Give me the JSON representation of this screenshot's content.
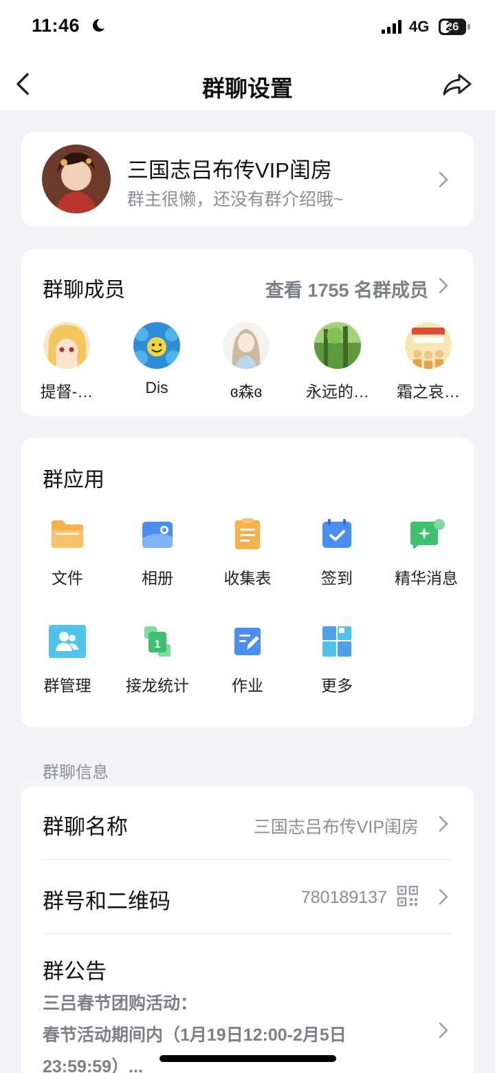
{
  "status_bar": {
    "time": "11:46",
    "network": "4G",
    "battery_level": "26"
  },
  "nav": {
    "title": "群聊设置"
  },
  "group": {
    "name": "三国志吕布传VIP闺房",
    "intro": "群主很懒，还没有群介绍哦~"
  },
  "members": {
    "title": "群聊成员",
    "view_all": "查看 1755 名群成员",
    "items": [
      {
        "name": "提督-…",
        "avatar": "anime-blonde-avatar"
      },
      {
        "name": "Dis",
        "avatar": "blue-smiley-avatar"
      },
      {
        "name": "ɞ森ɞ",
        "avatar": "anime-girl-avatar"
      },
      {
        "name": "永远的…",
        "avatar": "forest-avatar"
      },
      {
        "name": "霜之哀…",
        "avatar": "comic-avatar"
      }
    ]
  },
  "apps": {
    "title": "群应用",
    "items": [
      {
        "label": "文件",
        "icon": "folder-icon"
      },
      {
        "label": "相册",
        "icon": "album-icon"
      },
      {
        "label": "收集表",
        "icon": "form-icon"
      },
      {
        "label": "签到",
        "icon": "checkin-icon"
      },
      {
        "label": "精华消息",
        "icon": "highlight-icon"
      },
      {
        "label": "群管理",
        "icon": "group-manage-icon"
      },
      {
        "label": "接龙统计",
        "icon": "relay-icon"
      },
      {
        "label": "作业",
        "icon": "homework-icon"
      },
      {
        "label": "更多",
        "icon": "more-grid-icon"
      }
    ]
  },
  "info": {
    "header": "群聊信息",
    "name_label": "群聊名称",
    "name_value": "三国志吕布传VIP闺房",
    "number_label": "群号和二维码",
    "number_value": "780189137",
    "notice_label": "群公告",
    "notice_lines": [
      "三吕春节团购活动：",
      "春节活动期间内（1月19日12:00-2月5日",
      "23:59:59）..."
    ]
  },
  "colors": {
    "accent_blue": "#4a8ef2",
    "orange": "#f5b14c",
    "green": "#3cbf6e",
    "teal": "#4fc3c9"
  }
}
